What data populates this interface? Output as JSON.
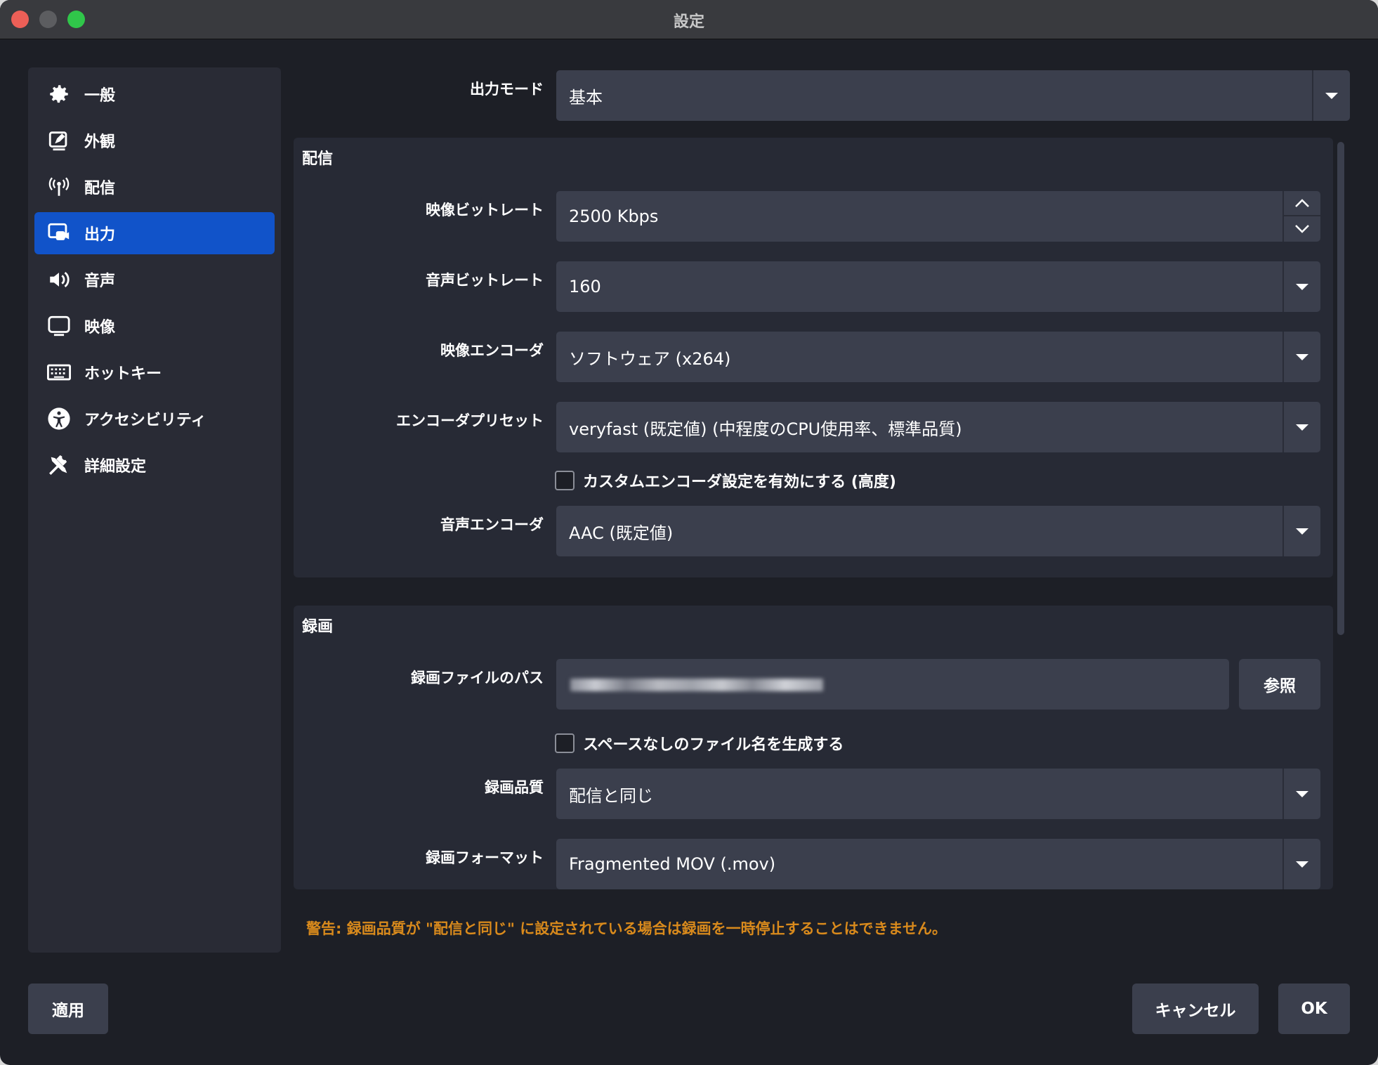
{
  "window": {
    "title": "設定"
  },
  "sidebar": {
    "items": [
      {
        "label": "一般",
        "icon": "gear-icon"
      },
      {
        "label": "外観",
        "icon": "appearance-icon"
      },
      {
        "label": "配信",
        "icon": "antenna-icon"
      },
      {
        "label": "出力",
        "icon": "output-icon",
        "active": true
      },
      {
        "label": "音声",
        "icon": "speaker-icon"
      },
      {
        "label": "映像",
        "icon": "monitor-icon"
      },
      {
        "label": "ホットキー",
        "icon": "keyboard-icon"
      },
      {
        "label": "アクセシビリティ",
        "icon": "accessibility-icon"
      },
      {
        "label": "詳細設定",
        "icon": "tools-icon"
      }
    ]
  },
  "output_mode": {
    "label": "出力モード",
    "value": "基本"
  },
  "streaming": {
    "title": "配信",
    "video_bitrate": {
      "label": "映像ビットレート",
      "value": "2500 Kbps"
    },
    "audio_bitrate": {
      "label": "音声ビットレート",
      "value": "160"
    },
    "video_encoder": {
      "label": "映像エンコーダ",
      "value": "ソフトウェア (x264)"
    },
    "encoder_preset": {
      "label": "エンコーダプリセット",
      "value": "veryfast (既定値) (中程度のCPU使用率、標準品質)"
    },
    "custom_encoder_checkbox": {
      "label": "カスタムエンコーダ設定を有効にする (高度)",
      "checked": false
    },
    "audio_encoder": {
      "label": "音声エンコーダ",
      "value": "AAC (既定値)"
    }
  },
  "recording": {
    "title": "録画",
    "path": {
      "label": "録画ファイルのパス",
      "browse_label": "参照"
    },
    "no_space_checkbox": {
      "label": "スペースなしのファイル名を生成する",
      "checked": false
    },
    "quality": {
      "label": "録画品質",
      "value": "配信と同じ"
    },
    "format": {
      "label": "録画フォーマット",
      "value": "Fragmented MOV (.mov)"
    }
  },
  "warning": "警告: 録画品質が \"配信と同じ\" に設定されている場合は録画を一時停止することはできません。",
  "buttons": {
    "apply": "適用",
    "cancel": "キャンセル",
    "ok": "OK"
  },
  "colors": {
    "accent": "#1153c9",
    "warning": "#d98a1c",
    "background": "#1d1f26",
    "panel": "#272a35",
    "field": "#3b3f4d"
  }
}
